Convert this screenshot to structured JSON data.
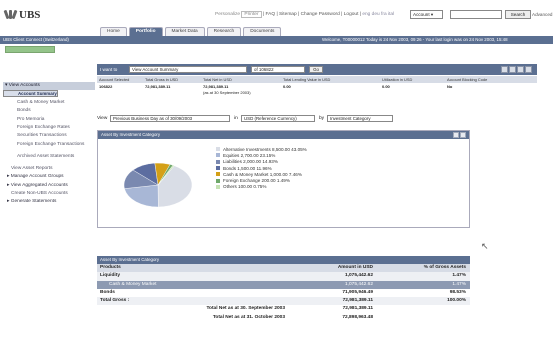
{
  "brand": {
    "name": "UBS"
  },
  "top_links": {
    "personalize": "Personalize",
    "print": "Printer",
    "faq": "FAQ",
    "sitemap": "Sitemap",
    "change_password": "Change Password",
    "logout": "Logout",
    "languages": "eng  deu  fra  ital",
    "account_select": "Account",
    "search_button": "Search",
    "advanced": "Advanced"
  },
  "tabs": [
    {
      "label": "Home"
    },
    {
      "label": "Portfolio"
    },
    {
      "label": "Market Data"
    },
    {
      "label": "Research"
    },
    {
      "label": "Documents"
    }
  ],
  "bluebar": {
    "left": "UBS Client Connect (Switzerland)",
    "right": "Welcome, T00000012  Today is 24 Nov 2003, 09:26 - Your last login was on 24 Nov 2003, 15:48"
  },
  "sidebar": {
    "items": [
      {
        "label": "View Accounts",
        "kind": "hdr"
      },
      {
        "label": "Account Summary",
        "kind": "sel"
      },
      {
        "label": "Maturity Schedule",
        "kind": ""
      },
      {
        "label": "Cash & Money Market",
        "kind": ""
      },
      {
        "label": "Bonds",
        "kind": ""
      },
      {
        "label": "Pro Memoria",
        "kind": ""
      },
      {
        "label": "Foreign Exchange Rates",
        "kind": ""
      },
      {
        "label": "Securities Transactions",
        "kind": ""
      },
      {
        "label": "Foreign Exchange Transactions",
        "kind": "two"
      },
      {
        "label": "Archived Asset Statements",
        "kind": "two"
      },
      {
        "label": "View Asset Reports",
        "kind": "sub"
      },
      {
        "label": "Manage Account Groups",
        "kind": "hdr2"
      },
      {
        "label": "View Aggregated Accounts",
        "kind": "hdr2"
      },
      {
        "label": "Create Non-UBS Accounts",
        "kind": "sub"
      },
      {
        "label": "Generate Statements",
        "kind": "hdr2"
      }
    ]
  },
  "filter": {
    "label": "I want to",
    "view_select": "View Account Summary",
    "of_select": "of 106822",
    "go": "Go"
  },
  "summary": {
    "headers": [
      "Account Selected",
      "Total Gross in USD",
      "Total Net in USD",
      "Total Lending Value in USD",
      "Utilization in USD",
      "Account Blocking Code"
    ],
    "values": [
      "106822",
      "72,981,389.11",
      "72,981,389.11",
      "0.00",
      "0.00",
      "No"
    ],
    "note": "(as at 30 September 2003)"
  },
  "view_row": {
    "prefix": "View",
    "period": "Previous Business Day as of 30/09/2003",
    "in": "in",
    "currency": "USD (Reference Currency)",
    "by": "by",
    "category": "Investment Category"
  },
  "asset_panel": {
    "title": "Asset By Investment Category"
  },
  "chart_data": {
    "type": "pie",
    "title": "Asset By Investment Category",
    "slices": [
      {
        "label": "Alternative Investments",
        "value": 43.05,
        "amount": "8,500.00",
        "color": "#d9dde6"
      },
      {
        "label": "Equities",
        "value": 23.15,
        "amount": "2,700.00",
        "color": "#a8b7d6"
      },
      {
        "label": "Liabilities",
        "value": 14.93,
        "amount": "2,000.00",
        "color": "#7a89b0"
      },
      {
        "label": "Bonds",
        "value": 11.96,
        "amount": "1,500.00",
        "color": "#5c6da0"
      },
      {
        "label": "Cash & Money Market",
        "value": 7.46,
        "amount": "1,000.00",
        "color": "#d4a017"
      },
      {
        "label": "Foreign Exchange",
        "value": 1.49,
        "amount": "200.00",
        "color": "#6fa86a"
      },
      {
        "label": "Others",
        "value": 0.75,
        "amount": "100.00",
        "color": "#c6e2b4"
      }
    ]
  },
  "table2": {
    "title": "Asset By Investment Category",
    "headers": [
      "Products",
      "Amount in USD",
      "% of Gross Assets"
    ],
    "rows": [
      {
        "label": "Liquidity",
        "amount": "1,075,442.62",
        "pct": "1.47%",
        "style": "lvl1"
      },
      {
        "label": "Cash & Money Market",
        "amount": "1,075,442.62",
        "pct": "1.47%",
        "style": "lvl2"
      },
      {
        "label": "Bonds",
        "amount": "71,905,946.49",
        "pct": "98.53%",
        "style": "bold"
      },
      {
        "label": "Total Gross :",
        "amount": "72,981,389.11",
        "pct": "100.00%",
        "style": "lvl1"
      },
      {
        "label": "Total Net as at 30. September 2003",
        "amount": "72,981,389.11",
        "pct": "",
        "style": "tot"
      },
      {
        "label": "Total Net as at 31. October 2003",
        "amount": "72,898,963.48",
        "pct": "",
        "style": "tot"
      }
    ]
  }
}
